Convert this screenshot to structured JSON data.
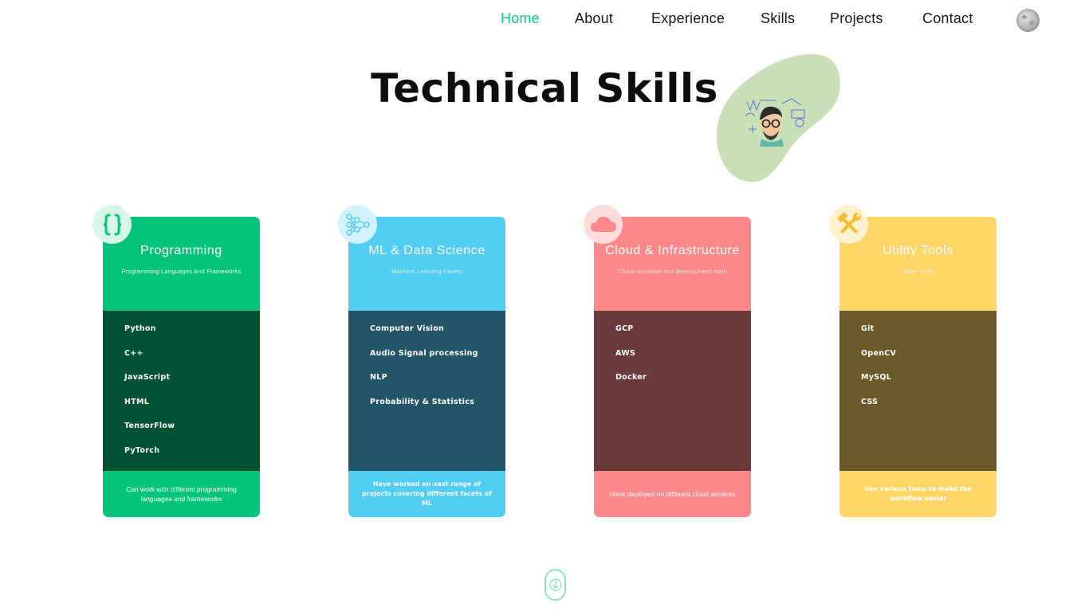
{
  "nav": {
    "items": [
      {
        "label": "Home",
        "active": true
      },
      {
        "label": "About"
      },
      {
        "label": "Experience"
      },
      {
        "label": "Skills"
      },
      {
        "label": "Projects"
      },
      {
        "label": "Contact"
      }
    ],
    "theme_toggle_icon": "moon-icon"
  },
  "main": {
    "title": "Technical Skills"
  },
  "cards": [
    {
      "title": "Programming",
      "subtitle": "Programming Languages And Frameworks",
      "icon": "curly-braces-icon",
      "skills": [
        "Python",
        "C++",
        "JavaScript",
        "HTML",
        "TensorFlow",
        "PyTorch"
      ],
      "note": "Can work with different programming languages and frameworks",
      "accent": "#03c47a",
      "dark": "#015234"
    },
    {
      "title": "ML & Data Science",
      "subtitle": "Machine Learning Facets",
      "icon": "neural-network-icon",
      "skills": [
        "Computer Vision",
        "Audio Signal processing",
        "NLP",
        "Probability & Statistics"
      ],
      "note": "Have worked on vast range of projects covering different facets of ML",
      "accent": "#52cdf3",
      "dark": "#235568"
    },
    {
      "title": "Cloud & Infrastructure",
      "subtitle": "Cloud solutions and development tools",
      "icon": "cloud-icon",
      "skills": [
        "GCP",
        "AWS",
        "Docker"
      ],
      "note": "Have deployed on different cloud services",
      "accent": "#fd8889",
      "dark": "#6a3a3b"
    },
    {
      "title": "Utility Tools",
      "subtitle": "Other Tools",
      "icon": "hammer-wrench-icon",
      "skills": [
        "Git",
        "OpenCV",
        "MySQL",
        "CSS"
      ],
      "note": "Use various tools to make the workflow easier",
      "accent": "#fed668",
      "dark": "#6a5a2b"
    }
  ],
  "scroll": {
    "icon": "arrow-down-icon"
  },
  "colors": {
    "active_nav": "#14c38e",
    "blob": "#c8dfb8"
  }
}
